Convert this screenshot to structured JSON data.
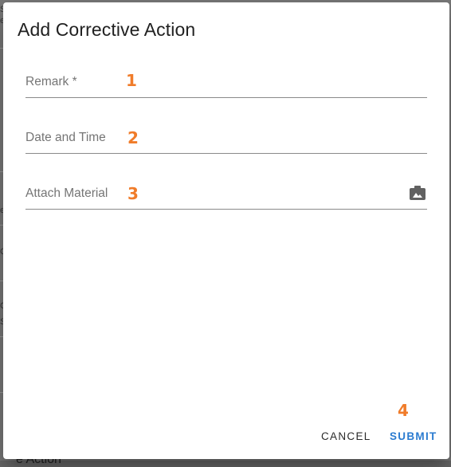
{
  "dialog": {
    "title": "Add Corrective Action",
    "fields": [
      {
        "label": "Remark *",
        "value": "",
        "marker": "1"
      },
      {
        "label": "Date and Time",
        "value": "",
        "marker": "2"
      },
      {
        "label": "Attach Material",
        "value": "",
        "marker": "3",
        "icon": "camera-icon"
      }
    ],
    "actions": {
      "cancel_label": "CANCEL",
      "submit_label": "SUBMIT",
      "submit_marker": "4"
    }
  },
  "background": {
    "fragments": [
      "S",
      "e",
      "e",
      "C",
      "C",
      "S",
      "e Action"
    ]
  },
  "colors": {
    "marker": "#f07c2a",
    "submit": "#2a7bd0",
    "underline": "#8a8a8a",
    "label": "#757575"
  }
}
